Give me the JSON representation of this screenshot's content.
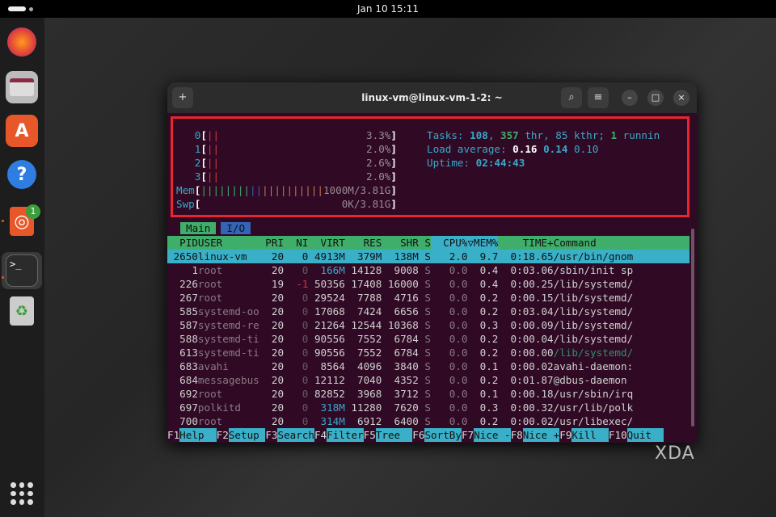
{
  "topbar": {
    "datetime": "Jan 10  15:11"
  },
  "dock": {
    "badge": "1",
    "items": [
      "firefox",
      "files",
      "app-center",
      "help",
      "ubuntu-software",
      "terminal",
      "trash"
    ]
  },
  "window": {
    "title": "linux-vm@linux-vm-1-2: ~",
    "new_tab": "+",
    "search": "⌕",
    "menu": "≡",
    "minimize": "–",
    "maximize": "□",
    "close": "×"
  },
  "meters": {
    "cpus": [
      {
        "id": "0",
        "bar": "||",
        "value": "3.3%"
      },
      {
        "id": "1",
        "bar": "||",
        "value": "2.0%"
      },
      {
        "id": "2",
        "bar": "||",
        "value": "2.6%"
      },
      {
        "id": "3",
        "bar": "||",
        "value": "2.0%"
      }
    ],
    "mem": {
      "label": "Mem",
      "bar": "||||||||||||||||||||",
      "value": "1000M/3.81G"
    },
    "swp": {
      "label": "Swp",
      "value": "0K/3.81G"
    },
    "tasks": {
      "label": "Tasks: ",
      "count": "108",
      "sep": ", ",
      "thr": "357",
      "thr_label": " thr, ",
      "kthr": "85 kthr; ",
      "running": "1",
      "running_label": " runnin"
    },
    "load": {
      "label": "Load average: ",
      "l1": "0.16",
      "l5": "0.14",
      "l15": "0.10"
    },
    "uptime": {
      "label": "Uptime: ",
      "value": "02:44:43"
    }
  },
  "tabs": [
    "Main",
    "I/O"
  ],
  "columns": [
    "PID",
    "USER",
    "PRI",
    "NI",
    "VIRT",
    "RES",
    "SHR",
    "S",
    "CPU%",
    "▽MEM%",
    "TIME+",
    "Command"
  ],
  "processes": [
    [
      "2650",
      "linux-vm",
      "20",
      "0",
      "4913M",
      "379M",
      "138M",
      "S",
      "2.0",
      "9.7",
      "0:18.65",
      "/usr/bin/gnom"
    ],
    [
      "1",
      "root",
      "20",
      "0",
      "166M",
      "14128",
      "9008",
      "S",
      "0.0",
      "0.4",
      "0:03.06",
      "/sbin/init sp"
    ],
    [
      "226",
      "root",
      "19",
      "-1",
      "50356",
      "17408",
      "16000",
      "S",
      "0.0",
      "0.4",
      "0:00.25",
      "/lib/systemd/"
    ],
    [
      "267",
      "root",
      "20",
      "0",
      "29524",
      "7788",
      "4716",
      "S",
      "0.0",
      "0.2",
      "0:00.15",
      "/lib/systemd/"
    ],
    [
      "585",
      "systemd-oo",
      "20",
      "0",
      "17068",
      "7424",
      "6656",
      "S",
      "0.0",
      "0.2",
      "0:03.04",
      "/lib/systemd/"
    ],
    [
      "587",
      "systemd-re",
      "20",
      "0",
      "21264",
      "12544",
      "10368",
      "S",
      "0.0",
      "0.3",
      "0:00.09",
      "/lib/systemd/"
    ],
    [
      "588",
      "systemd-ti",
      "20",
      "0",
      "90556",
      "7552",
      "6784",
      "S",
      "0.0",
      "0.2",
      "0:00.04",
      "/lib/systemd/"
    ],
    [
      "613",
      "systemd-ti",
      "20",
      "0",
      "90556",
      "7552",
      "6784",
      "S",
      "0.0",
      "0.2",
      "0:00.00",
      "/lib/systemd/"
    ],
    [
      "683",
      "avahi",
      "20",
      "0",
      "8564",
      "4096",
      "3840",
      "S",
      "0.0",
      "0.1",
      "0:00.02",
      "avahi-daemon:"
    ],
    [
      "684",
      "messagebus",
      "20",
      "0",
      "12112",
      "7040",
      "4352",
      "S",
      "0.0",
      "0.2",
      "0:01.87",
      "@dbus-daemon"
    ],
    [
      "692",
      "root",
      "20",
      "0",
      "82852",
      "3968",
      "3712",
      "S",
      "0.0",
      "0.1",
      "0:00.18",
      "/usr/sbin/irq"
    ],
    [
      "697",
      "polkitd",
      "20",
      "0",
      "318M",
      "11280",
      "7620",
      "S",
      "0.0",
      "0.3",
      "0:00.32",
      "/usr/lib/polk"
    ],
    [
      "700",
      "root",
      "20",
      "0",
      "314M",
      "6912",
      "6400",
      "S",
      "0.0",
      "0.2",
      "0:00.02",
      "/usr/libexec/"
    ]
  ],
  "function_keys": [
    [
      "F1",
      "Help  "
    ],
    [
      "F2",
      "Setup "
    ],
    [
      "F3",
      "Search"
    ],
    [
      "F4",
      "Filter"
    ],
    [
      "F5",
      "Tree  "
    ],
    [
      "F6",
      "SortBy"
    ],
    [
      "F7",
      "Nice -"
    ],
    [
      "F8",
      "Nice +"
    ],
    [
      "F9",
      "Kill  "
    ],
    [
      "F10",
      "Quit  "
    ]
  ],
  "watermark": "XDA"
}
